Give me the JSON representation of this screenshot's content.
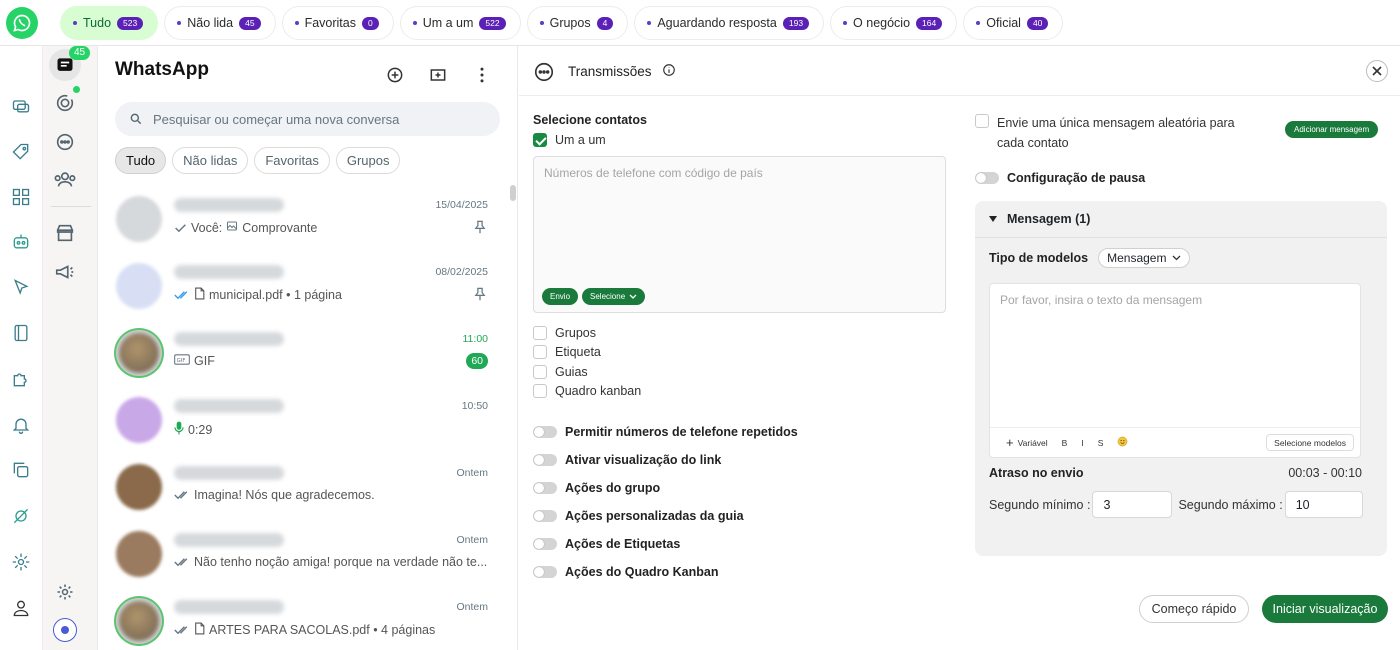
{
  "filters": [
    {
      "label": "Tudo",
      "count": "523",
      "active": true
    },
    {
      "label": "Não lida",
      "count": "45"
    },
    {
      "label": "Favoritas",
      "count": "0"
    },
    {
      "label": "Um a um",
      "count": "522"
    },
    {
      "label": "Grupos",
      "count": "4"
    },
    {
      "label": "Aguardando resposta",
      "count": "193"
    },
    {
      "label": "O negócio",
      "count": "164"
    },
    {
      "label": "Oficial",
      "count": "40"
    }
  ],
  "nav": {
    "chats_badge": "45"
  },
  "chats": {
    "title": "WhatsApp",
    "search_placeholder": "Pesquisar ou começar uma nova conversa",
    "pills": [
      "Tudo",
      "Não lidas",
      "Favoritas",
      "Grupos"
    ],
    "items": [
      {
        "time": "15/04/2025",
        "preview": "Você: ",
        "preview2": "Comprovante",
        "icon": "image-icon",
        "check": "single",
        "pinned": true
      },
      {
        "time": "08/02/2025",
        "preview": "municipal.pdf • 1 página",
        "icon": "document-icon",
        "check": "double-blue",
        "pinned": true
      },
      {
        "time": "11:00",
        "preview": "GIF",
        "icon": "gif-icon",
        "unread": "60",
        "green": true
      },
      {
        "time": "10:50",
        "preview": "0:29",
        "icon": "mic-icon"
      },
      {
        "time": "Ontem",
        "preview": "Imagina! Nós que agradecemos.",
        "check": "double"
      },
      {
        "time": "Ontem",
        "preview": "Não tenho noção amiga! porque na verdade não te...",
        "check": "double"
      },
      {
        "time": "Ontem",
        "preview": "ARTES PARA SACOLAS.pdf • 4 páginas",
        "icon": "document-icon",
        "check": "double"
      }
    ]
  },
  "panel": {
    "title": "Transmissões",
    "select_contacts": "Selecione contatos",
    "one_to_one": "Um a um",
    "phone_placeholder": "Números de telefone com código de país",
    "send_btn": "Envio",
    "select_btn": "Selecione",
    "checkboxes": [
      "Grupos",
      "Etiqueta",
      "Guias",
      "Quadro kanban"
    ],
    "toggles": [
      "Permitir números de telefone repetidos",
      "Ativar visualização do link",
      "Ações do grupo",
      "Ações personalizadas da guia",
      "Ações de Etiquetas",
      "Ações do Quadro Kanban"
    ],
    "random_msg": "Envie uma única mensagem aleatória para cada contato",
    "add_message": "Adicionar mensagem",
    "pause_config": "Configuração de pausa",
    "message_section": "Mensagem (1)",
    "model_type_label": "Tipo de modelos",
    "model_type_value": "Mensagem",
    "message_placeholder": "Por favor, insira o texto da mensagem",
    "tool_variable": "Variável",
    "tool_bold": "B",
    "tool_italic": "I",
    "tool_strike": "S",
    "select_models": "Selecione modelos",
    "delay_label": "Atraso no envio",
    "delay_range": "00:03 - 00:10",
    "min_label": "Segundo mínimo :",
    "min_value": "3",
    "max_label": "Segundo máximo :",
    "max_value": "10",
    "quick_start": "Começo rápido",
    "start_preview": "Iniciar visualização"
  }
}
